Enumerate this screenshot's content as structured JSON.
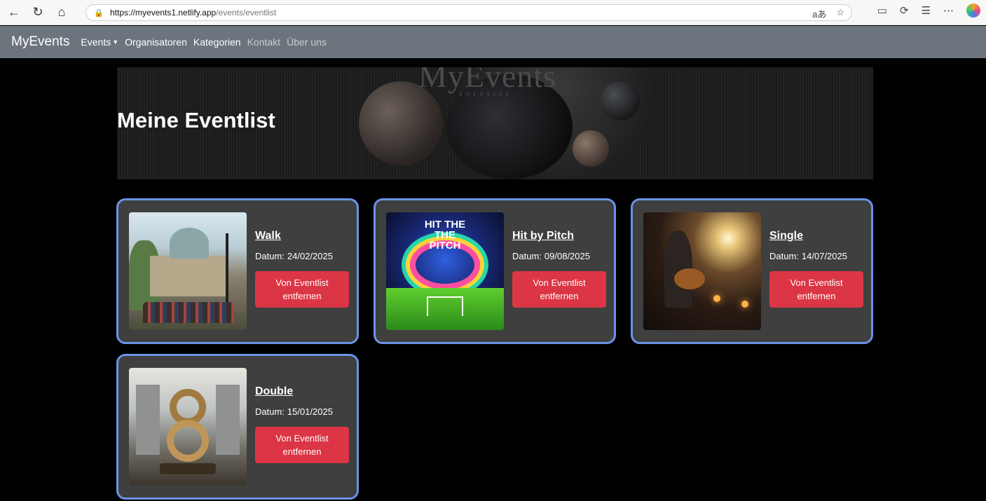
{
  "browser": {
    "url_host": "https://myevents1.netlify.app",
    "url_path": "/events/eventlist",
    "read_aloud": "aあ"
  },
  "navbar": {
    "brand": "MyEvents",
    "events": "Events",
    "organisatoren": "Organisatoren",
    "kategorien": "Kategorien",
    "kontakt": "Kontakt",
    "ueber_uns": "Über uns"
  },
  "hero": {
    "title": "Meine Eventlist",
    "bg_logo": "MyEvents",
    "bg_sub": "SOFTSITE"
  },
  "pitch_thumb_text": "HIT THE\nTHE\nPITCH",
  "events": [
    {
      "title": "Walk",
      "date_label": "Datum:",
      "date": "24/02/2025",
      "button": "Von Eventlist entfernen"
    },
    {
      "title": "Hit by Pitch",
      "date_label": "Datum:",
      "date": "09/08/2025",
      "button": "Von Eventlist entfernen"
    },
    {
      "title": "Single",
      "date_label": "Datum:",
      "date": "14/07/2025",
      "button": "Von Eventlist entfernen"
    },
    {
      "title": "Double",
      "date_label": "Datum:",
      "date": "15/01/2025",
      "button": "Von Eventlist entfernen"
    }
  ],
  "colors": {
    "navbar": "#6c757d",
    "card_bg": "#3f3f3f",
    "card_border": "#6b93e6",
    "button_danger": "#dc3545"
  }
}
